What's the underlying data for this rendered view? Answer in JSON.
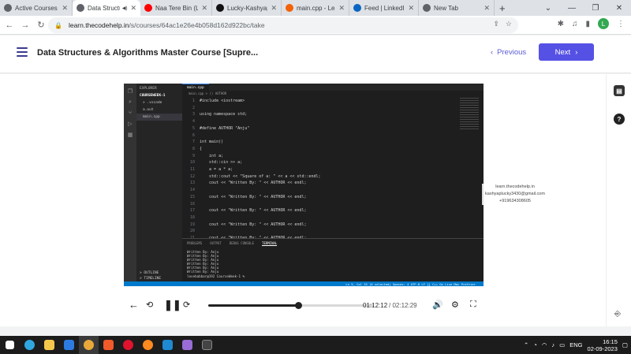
{
  "browser": {
    "tabs": [
      {
        "title": "Active Courses",
        "favicon": "codehelp-icon",
        "color": "#5f6368",
        "active": false,
        "marker": ""
      },
      {
        "title": "Data Structu",
        "favicon": "codehelp-icon",
        "color": "#5f6368",
        "active": true,
        "marker": "◀)"
      },
      {
        "title": "Naa Tere Bin (Lyri",
        "favicon": "youtube-icon",
        "color": "#ff0000",
        "active": false,
        "marker": ""
      },
      {
        "title": "Lucky-Kashyap/T",
        "favicon": "github-icon",
        "color": "#111111",
        "active": false,
        "marker": ""
      },
      {
        "title": "main.cpp - Learn",
        "favicon": "replit-icon",
        "color": "#f26207",
        "active": false,
        "marker": ""
      },
      {
        "title": "Feed | LinkedIn",
        "favicon": "linkedin-icon",
        "color": "#0a66c2",
        "active": false,
        "marker": ""
      },
      {
        "title": "New Tab",
        "favicon": "chrome-icon",
        "color": "#5f6368",
        "active": false,
        "marker": ""
      }
    ],
    "url_host": "learn.thecodehelp.in",
    "url_path": "/s/courses/64ac1e26e4b058d162d922bc/take",
    "avatar_letter": "L"
  },
  "header": {
    "course_title": "Data Structures & Algorithms Master Course [Supre...",
    "previous_label": "Previous",
    "next_label": "Next"
  },
  "video": {
    "explorer_title": "EXPLORER",
    "folder": "COURSEWEEK-1",
    "files": [
      "> .vscode",
      "a.out",
      "main.cpp"
    ],
    "outline": "> OUTLINE",
    "timeline": "> TIMELINE",
    "editor_tab": "main.cpp",
    "breadcrumb": "main.cpp > () AUTHOR",
    "code_lines": [
      "#include <iostream>",
      "",
      "using namespace std;",
      "",
      "#define AUTHOR \"Anju\"",
      "",
      "int main()",
      "{",
      "    int a;",
      "    std::cin >> a;",
      "    a = a * a;",
      "    std::cout << \"Square of a: \" << a << std::endl;",
      "    cout << \"Written By: \" << AUTHOR << endl;",
      "",
      "    cout << \"Written By: \" << AUTHOR << endl;",
      "",
      "    cout << \"Written By: \" << AUTHOR << endl;",
      "",
      "    cout << \"Written By: \" << AUTHOR << endl;",
      "",
      "    cout << \"Written By: \" << AUTHOR << endl;",
      "",
      "    cout << \"Written By: \" << AUTHOR << endl;",
      ""
    ],
    "panel_tabs": [
      "PROBLEMS",
      "OUTPUT",
      "DEBUG CONSOLE",
      "TERMINAL"
    ],
    "terminal_lines": [
      "Written By: Anju",
      "Written By: Anju",
      "Written By: Anju",
      "Written By: Anju",
      "Written By: Anju",
      "Written By: Anju",
      "lovebabbar@192 CourseWeek-1 %"
    ],
    "status_text": "Ln 5, Col 15 (6 selected)  Spaces: 4  UTF-8  LF  {} C++  Go Live  Mac  Prettier",
    "watermark": [
      "learn.thecodehelp.in",
      "kashyaplucky3430@gmail.com",
      "+919634308605"
    ]
  },
  "player": {
    "current_time": "01:12:12",
    "total_time": "/ 02:12:29",
    "progress": 0.545
  },
  "taskbar": {
    "language": "ENG",
    "time": "16:15",
    "date": "02-09-2023"
  }
}
